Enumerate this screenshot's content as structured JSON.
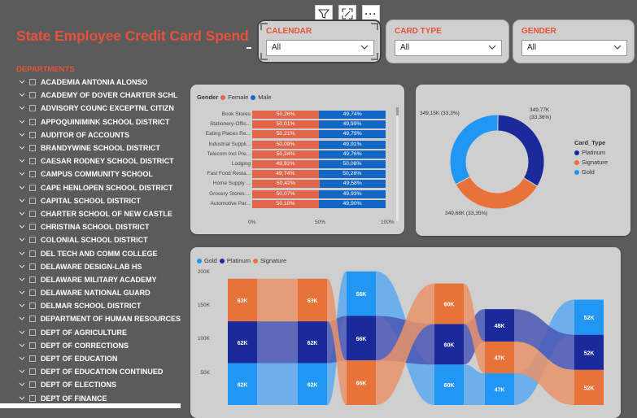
{
  "title": "State Employee Credit Card Spend",
  "toolbar": {
    "filter_icon": "filter-icon",
    "focus_icon": "focus-mode-icon",
    "more_icon": "more-options-icon",
    "more_glyph": "···"
  },
  "slicers": [
    {
      "label": "CALENDAR",
      "value": "All"
    },
    {
      "label": "CARD TYPE",
      "value": "All"
    },
    {
      "label": "GENDER",
      "value": "All"
    }
  ],
  "departments": {
    "header": "DEPARTMENTS",
    "items": [
      "ACADEMIA ANTONIA ALONSO",
      "ACADEMY OF DOVER CHARTER SCHL",
      "ADVISORY COUNC EXCEPTNL CITIZN",
      "APPOQUINIMINK SCHOOL DISTRICT",
      "AUDITOR OF ACCOUNTS",
      "BRANDYWINE SCHOOL DISTRICT",
      "CAESAR RODNEY SCHOOL DISTRICT",
      "CAMPUS COMMUNITY SCHOOL",
      "CAPE HENLOPEN SCHOOL DISTRICT",
      "CAPITAL SCHOOL DISTRICT",
      "CHARTER SCHOOL OF NEW CASTLE",
      "CHRISTINA SCHOOL DISTRICT",
      "COLONIAL SCHOOL DISTRICT",
      "DEL TECH AND COMM COLLEGE",
      "DELAWARE DESIGN-LAB HS",
      "DELAWARE MILITARY ACADEMY",
      "DELAWARE NATIONAL GUARD",
      "DELMAR SCHOOL DISTRICT",
      "DEPARTMENT OF HUMAN RESOURCES",
      "DEPT OF AGRICULTURE",
      "DEPT OF CORRECTIONS",
      "DEPT OF EDUCATION",
      "DEPT OF EDUCATION CONTINUED",
      "DEPT OF ELECTIONS",
      "DEPT OF FINANCE"
    ]
  },
  "colors": {
    "female": "#e0654a",
    "male": "#1267c5",
    "platinum": "#1a2a9a",
    "signature": "#e8733a",
    "gold": "#2196f3"
  },
  "chart_data": [
    {
      "type": "bar",
      "stacked": "100%",
      "orientation": "horizontal",
      "legend_title": "Gender",
      "series": [
        {
          "name": "Female",
          "values": [
            50.26,
            50.01,
            50.21,
            50.09,
            50.24,
            49.92,
            49.74,
            50.42,
            50.07,
            50.1
          ]
        },
        {
          "name": "Male",
          "values": [
            49.74,
            49.99,
            49.79,
            49.91,
            49.76,
            50.08,
            50.26,
            49.58,
            49.93,
            49.9
          ]
        }
      ],
      "value_labels": {
        "Female": [
          "50,26%",
          "50,01%",
          "50,21%",
          "50,09%",
          "50,24%",
          "49,92%",
          "49,74%",
          "50,42%",
          "50,07%",
          "50,10%"
        ],
        "Male": [
          "49,74%",
          "49,99%",
          "49,79%",
          "49,91%",
          "49,76%",
          "50,08%",
          "50,26%",
          "49,58%",
          "49,93%",
          "49,90%"
        ]
      },
      "categories": [
        "Book Stores",
        "Stationery-Offic...",
        "Eating Places Re...",
        "Industrial Suppli...",
        "Telecom Incl Pre...",
        "Lodging",
        "Fast Food Resta...",
        "Home Supply ...",
        "Grocery Stores ...",
        "Automotive Par..."
      ],
      "x_ticks": [
        "0%",
        "50%",
        "100%"
      ],
      "xlim": [
        0,
        100
      ]
    },
    {
      "type": "pie",
      "donut": true,
      "legend_title": "Card_Type",
      "slices": [
        {
          "name": "Platinum",
          "value": 349770,
          "label": "349,77K\n(33,36%)"
        },
        {
          "name": "Signature",
          "value": 349680,
          "label": "349,68K (33,35%)"
        },
        {
          "name": "Gold",
          "value": 349150,
          "label": "349,15K (33,3%)"
        }
      ]
    },
    {
      "type": "area",
      "subtype": "ribbon",
      "series": [
        {
          "name": "Gold",
          "values": [
            62,
            62,
            66,
            60,
            47,
            52
          ]
        },
        {
          "name": "Platinum",
          "values": [
            62,
            62,
            66,
            60,
            48,
            52
          ]
        },
        {
          "name": "Signature",
          "values": [
            63,
            63,
            66,
            60,
            47,
            52
          ]
        }
      ],
      "stack_order": [
        [
          "Gold",
          "Platinum",
          "Signature"
        ],
        [
          "Gold",
          "Platinum",
          "Signature"
        ],
        [
          "Signature",
          "Platinum",
          "Gold"
        ],
        [
          "Gold",
          "Platinum",
          "Signature"
        ],
        [
          "Gold",
          "Signature",
          "Platinum"
        ],
        [
          "Signature",
          "Platinum",
          "Gold"
        ]
      ],
      "value_labels": {
        "Gold": [
          "62K",
          "62K",
          "66K",
          "60K",
          "47K",
          "52K"
        ],
        "Platinum": [
          "62K",
          "62K",
          "66K",
          "60K",
          "48K",
          "52K"
        ],
        "Signature": [
          "63K",
          "63K",
          "66K",
          "60K",
          "47K",
          "52K"
        ]
      },
      "y_ticks": [
        "200K",
        "150K",
        "100K",
        "50K"
      ],
      "ylim": [
        0,
        200
      ]
    }
  ]
}
